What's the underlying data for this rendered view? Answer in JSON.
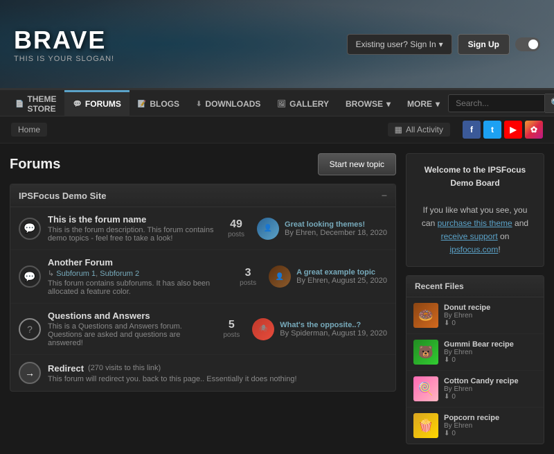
{
  "header": {
    "brand_title": "BRAVE",
    "brand_slogan": "THIS IS YOUR SLOGAN!",
    "sign_in_label": "Existing user? Sign In",
    "sign_up_label": "Sign Up"
  },
  "nav": {
    "items": [
      {
        "id": "theme-store",
        "label": "THEME STORE",
        "icon": "📄",
        "active": false
      },
      {
        "id": "forums",
        "label": "FORUMS",
        "icon": "💬",
        "active": true
      },
      {
        "id": "blogs",
        "label": "BLOGS",
        "icon": "📝",
        "active": false
      },
      {
        "id": "downloads",
        "label": "DOWNLOADS",
        "icon": "⬇",
        "active": false
      },
      {
        "id": "gallery",
        "label": "GALLERY",
        "icon": "🖼",
        "active": false
      },
      {
        "id": "browse",
        "label": "BROWSE",
        "icon": "",
        "active": false,
        "has_dropdown": true
      },
      {
        "id": "more",
        "label": "MORE",
        "icon": "",
        "active": false,
        "has_dropdown": true
      }
    ],
    "search_placeholder": "Search..."
  },
  "breadcrumb": {
    "home": "Home",
    "activity_label": "All Activity"
  },
  "social": {
    "facebook": "f",
    "twitter": "t",
    "youtube": "▶",
    "instagram": "📷"
  },
  "forums_page": {
    "title": "Forums",
    "start_topic_label": "Start new topic",
    "group_name": "IPSFocus Demo Site",
    "forums": [
      {
        "id": "forum1",
        "name": "This is the forum name",
        "description": "This is the forum description. This forum contains demo topics - feel free to take a look!",
        "posts": 49,
        "last_post_title": "Great looking themes!",
        "last_post_by": "By Ehren, December 18, 2020",
        "icon_type": "bubble",
        "avatar_class": "av-blue"
      },
      {
        "id": "forum2",
        "name": "Another Forum",
        "subforums": [
          "Subforum 1",
          "Subforum 2"
        ],
        "description": "This forum contains subforums. It has also been allocated a feature color.",
        "posts": 3,
        "last_post_title": "A great example topic",
        "last_post_by": "By Ehren, August 25, 2020",
        "icon_type": "bubble",
        "avatar_class": "av-brown"
      },
      {
        "id": "forum3",
        "name": "Questions and Answers",
        "description": "This is a Questions and Answers forum. Questions are asked and questions are answered!",
        "posts": 5,
        "last_post_title": "What's the opposite..?",
        "last_post_by": "By Spiderman, August 19, 2020",
        "icon_type": "question",
        "avatar_class": "av-spider"
      },
      {
        "id": "forum4",
        "name": "Redirect",
        "redirect_label": "(270 visits to this link)",
        "description": "This forum will redirect you. back to this page.. Essentially it does nothing!",
        "icon_type": "redirect"
      }
    ]
  },
  "sidebar": {
    "welcome_title": "Welcome to the IPSFocus Demo Board",
    "welcome_text": "If you like what you see, you can",
    "purchase_link": "purchase this theme",
    "and_text": "and",
    "support_link": "receive support",
    "support_text": "on",
    "site_link": "ipsfocus.com",
    "exclamation": "!",
    "recent_files_title": "Recent Files",
    "files": [
      {
        "id": "file1",
        "title": "Donut recipe",
        "author": "By Ehren",
        "count": "0",
        "thumb_class": "donut",
        "emoji": "🍩"
      },
      {
        "id": "file2",
        "title": "Gummi Bear recipe",
        "author": "By Ehren",
        "count": "0",
        "thumb_class": "gummi",
        "emoji": "🐻"
      },
      {
        "id": "file3",
        "title": "Cotton Candy recipe",
        "author": "By Ehren",
        "count": "0",
        "thumb_class": "cotton",
        "emoji": "🍭"
      },
      {
        "id": "file4",
        "title": "Popcorn recipe",
        "author": "By Ehren",
        "count": "0",
        "thumb_class": "popcorn",
        "emoji": "🍿"
      }
    ]
  }
}
